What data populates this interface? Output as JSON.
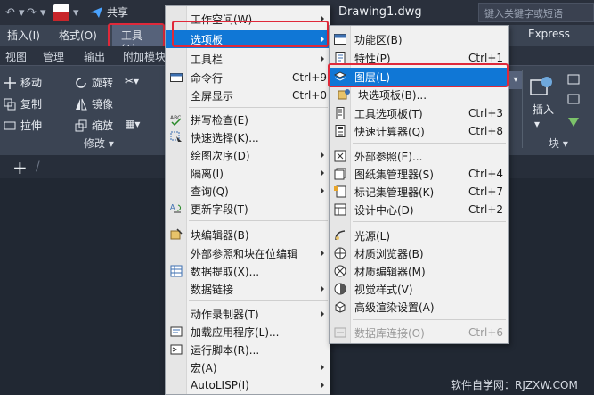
{
  "window": {
    "share_label": "共享",
    "document_title": "Drawing1.dwg",
    "search_placeholder": "键入关键字或短语"
  },
  "menubar": {
    "items": [
      "插入(I)",
      "格式(O)",
      "工具(T)"
    ],
    "right_item": "Express"
  },
  "ribbon_tabs": [
    "视图",
    "管理",
    "输出",
    "附加模块"
  ],
  "ribbon": {
    "tools": [
      "移动",
      "旋转",
      "复制",
      "镜像",
      "拉伸",
      "缩放"
    ],
    "modify_panel_label": "修改 ▾",
    "insert_label": "插入",
    "block_panel_label": "块 ▾"
  },
  "tools_menu": {
    "items": [
      {
        "label": "工作空间(W)",
        "submenu": true
      },
      {
        "label": "选项板",
        "submenu": true,
        "highlighted": true
      },
      {
        "label": "工具栏",
        "submenu": true
      },
      {
        "label": "命令行",
        "shortcut": "Ctrl+9",
        "icon": "command-line-icon"
      },
      {
        "label": "全屏显示",
        "shortcut": "Ctrl+0"
      },
      {
        "label": "拼写检查(E)",
        "icon": "spell-check-icon"
      },
      {
        "label": "快速选择(K)...",
        "icon": "quick-select-icon"
      },
      {
        "label": "绘图次序(D)",
        "submenu": true
      },
      {
        "label": "隔离(I)",
        "submenu": true
      },
      {
        "label": "查询(Q)",
        "submenu": true
      },
      {
        "label": "更新字段(T)",
        "icon": "update-field-icon"
      },
      {
        "label": "块编辑器(B)",
        "icon": "block-editor-icon"
      },
      {
        "label": "外部参照和块在位编辑",
        "submenu": true
      },
      {
        "label": "数据提取(X)...",
        "icon": "data-extraction-icon"
      },
      {
        "label": "数据链接",
        "submenu": true
      },
      {
        "label": "动作录制器(T)",
        "submenu": true
      },
      {
        "label": "加载应用程序(L)...",
        "icon": "load-app-icon"
      },
      {
        "label": "运行脚本(R)...",
        "icon": "run-script-icon"
      },
      {
        "label": "宏(A)",
        "submenu": true
      },
      {
        "label": "AutoLISP(I)",
        "submenu": true
      }
    ]
  },
  "palettes_menu": {
    "items": [
      {
        "label": "功能区(B)",
        "icon": "ribbon-icon"
      },
      {
        "label": "特性(P)",
        "shortcut": "Ctrl+1",
        "icon": "properties-icon"
      },
      {
        "label": "图层(L)",
        "icon": "layers-icon",
        "highlighted": true
      },
      {
        "label": "块选项板(B)...",
        "icon": "block-palette-icon"
      },
      {
        "label": "工具选项板(T)",
        "shortcut": "Ctrl+3",
        "icon": "tool-palettes-icon"
      },
      {
        "label": "快速计算器(Q)",
        "shortcut": "Ctrl+8",
        "icon": "quick-calc-icon"
      },
      {
        "label": "外部参照(E)...",
        "icon": "xref-icon"
      },
      {
        "label": "图纸集管理器(S)",
        "shortcut": "Ctrl+4",
        "icon": "sheet-set-icon"
      },
      {
        "label": "标记集管理器(K)",
        "shortcut": "Ctrl+7",
        "icon": "markup-set-icon"
      },
      {
        "label": "设计中心(D)",
        "shortcut": "Ctrl+2",
        "icon": "design-center-icon"
      },
      {
        "label": "光源(L)",
        "icon": "lights-icon"
      },
      {
        "label": "材质浏览器(B)",
        "icon": "materials-browser-icon"
      },
      {
        "label": "材质编辑器(M)",
        "icon": "materials-editor-icon"
      },
      {
        "label": "视觉样式(V)",
        "icon": "visual-styles-icon"
      },
      {
        "label": "高级渲染设置(A)",
        "icon": "render-settings-icon"
      },
      {
        "label": "数据库连接(O)",
        "shortcut": "Ctrl+6",
        "icon": "db-connect-icon",
        "disabled": true
      }
    ]
  },
  "watermark": "软件自学网：RJZXW.COM",
  "colors": {
    "highlight": "#1077d6",
    "annotation_frame": "#e0293a",
    "menu_background": "#f1f1f1"
  }
}
